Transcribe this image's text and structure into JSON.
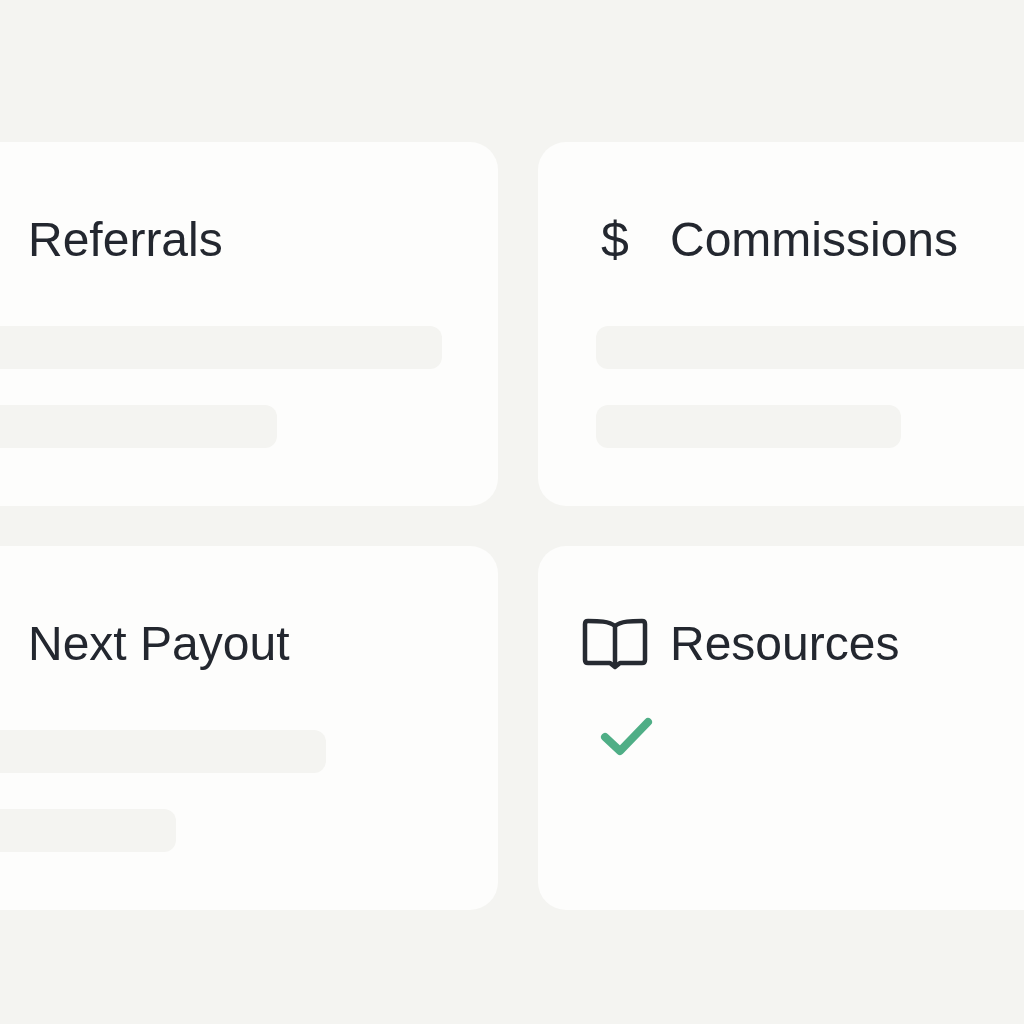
{
  "cards": [
    {
      "title": "Referrals",
      "kind": "plain",
      "body": {
        "kind": "skeleton"
      }
    },
    {
      "title": "Commissions",
      "kind": "symbol",
      "symbol": "$",
      "body": {
        "kind": "skeleton"
      }
    },
    {
      "title": "Next Payout",
      "kind": "plain",
      "body": {
        "kind": "skeleton"
      }
    },
    {
      "title": "Resources",
      "kind": "book",
      "body": {
        "kind": "check"
      }
    }
  ]
}
